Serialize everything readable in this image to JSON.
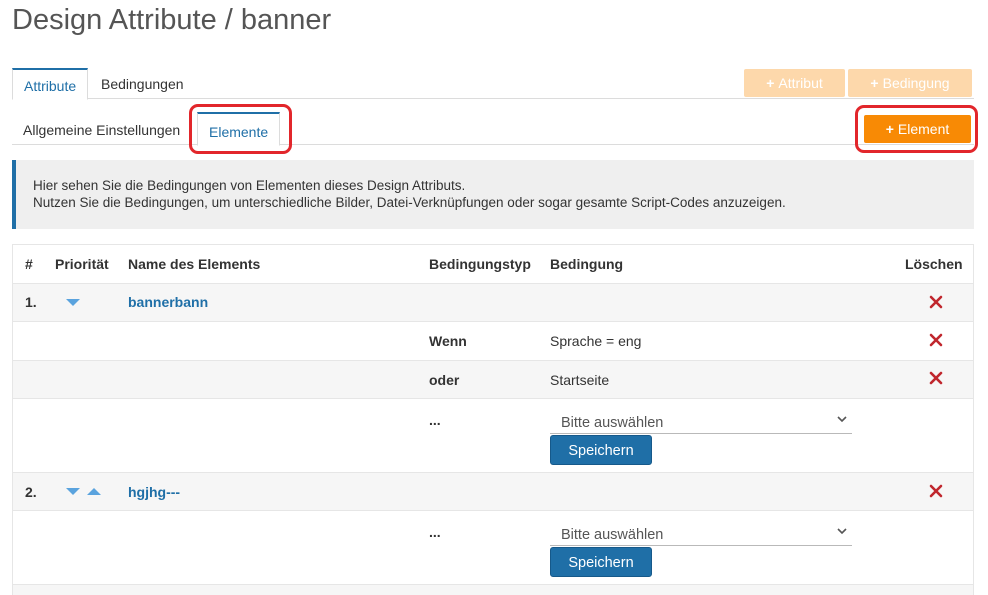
{
  "page": {
    "title": "Design Attribute / banner"
  },
  "tabs": {
    "attribute": "Attribute",
    "bedingungen": "Bedingungen"
  },
  "actions": {
    "add_attribut": "Attribut",
    "add_bedingung": "Bedingung",
    "add_element": "Element"
  },
  "subtabs": {
    "allgemeine": "Allgemeine Einstellungen",
    "elemente": "Elemente"
  },
  "info": {
    "line1": "Hier sehen Sie die Bedingungen von Elementen dieses Design Attributs.",
    "line2": "Nutzen Sie die Bedingungen, um unterschiedliche Bilder, Datei-Verknüpfungen oder sogar gesamte Script-Codes anzuzeigen."
  },
  "table": {
    "headers": {
      "num": "#",
      "prio": "Priorität",
      "name": "Name des Elements",
      "type": "Bedingungstyp",
      "cond": "Bedingung",
      "del": "Löschen"
    },
    "elements": [
      {
        "num": "1.",
        "name": "bannerbann",
        "conditions": [
          {
            "type": "Wenn",
            "condition": "Sprache = eng"
          },
          {
            "type": "oder",
            "condition": "Startseite"
          }
        ],
        "new_condition": {
          "type": "...",
          "select": "Bitte auswählen",
          "save": "Speichern"
        }
      },
      {
        "num": "2.",
        "name": "hgjhg---",
        "conditions": [],
        "new_condition": {
          "type": "...",
          "select": "Bitte auswählen",
          "save": "Speichern"
        }
      }
    ]
  },
  "colors": {
    "accent": "#1f6fa7",
    "orange": "#f88a05",
    "orange_faded": "#fdd8ab",
    "highlight": "#e2262b",
    "delete": "#c0262d"
  },
  "icons": {
    "delete": "x-delete-icon",
    "down": "triangle-down-icon",
    "up": "triangle-up-icon",
    "plus": "plus-icon",
    "chevron": "chevron-down-icon"
  }
}
